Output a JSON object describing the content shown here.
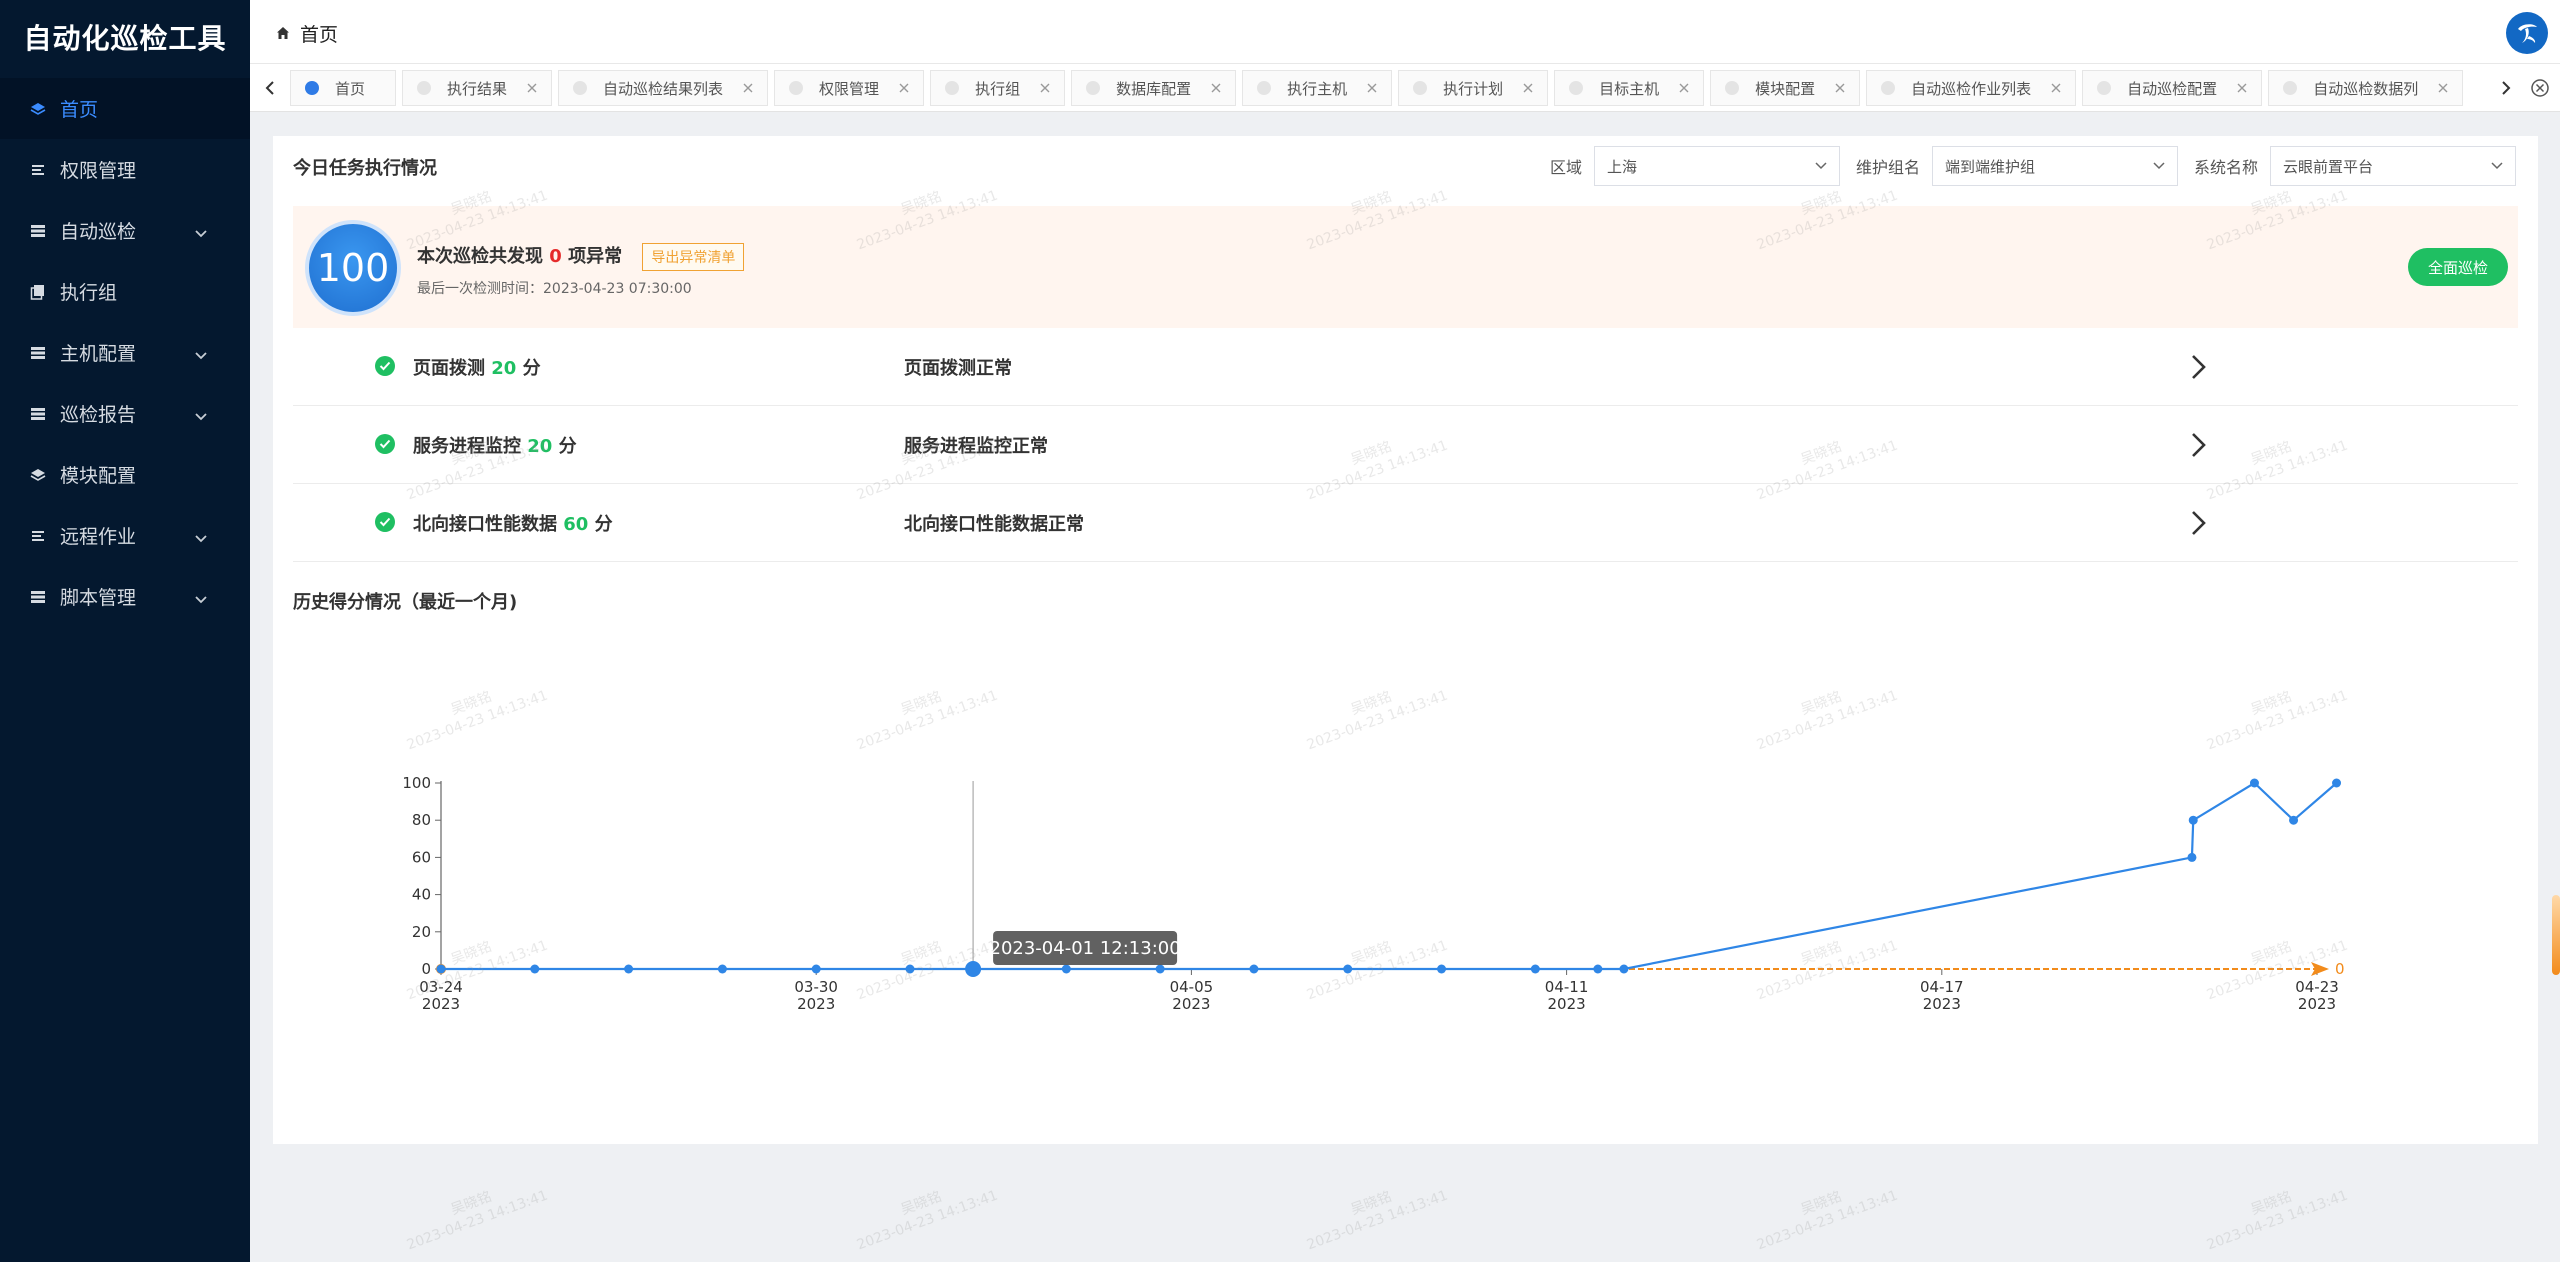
{
  "app": {
    "title": "自动化巡检工具"
  },
  "sidebar": {
    "items": [
      {
        "label": "首页",
        "icon": "layers-icon",
        "active": true,
        "has_submenu": false
      },
      {
        "label": "权限管理",
        "icon": "list-icon",
        "active": false,
        "has_submenu": false
      },
      {
        "label": "自动巡检",
        "icon": "table-icon",
        "active": false,
        "has_submenu": true
      },
      {
        "label": "执行组",
        "icon": "copy-icon",
        "active": false,
        "has_submenu": false
      },
      {
        "label": "主机配置",
        "icon": "table-icon",
        "active": false,
        "has_submenu": true
      },
      {
        "label": "巡检报告",
        "icon": "table-icon",
        "active": false,
        "has_submenu": true
      },
      {
        "label": "模块配置",
        "icon": "layers-icon",
        "active": false,
        "has_submenu": false
      },
      {
        "label": "远程作业",
        "icon": "list-icon",
        "active": false,
        "has_submenu": true
      },
      {
        "label": "脚本管理",
        "icon": "table-icon",
        "active": false,
        "has_submenu": true
      }
    ]
  },
  "header": {
    "breadcrumb": "首页",
    "brand_icon": "china-telecom-logo-icon"
  },
  "tabs": [
    {
      "label": "首页",
      "active": true
    },
    {
      "label": "执行结果",
      "active": false
    },
    {
      "label": "自动巡检结果列表",
      "active": false
    },
    {
      "label": "权限管理",
      "active": false
    },
    {
      "label": "执行组",
      "active": false
    },
    {
      "label": "数据库配置",
      "active": false
    },
    {
      "label": "执行主机",
      "active": false
    },
    {
      "label": "执行计划",
      "active": false
    },
    {
      "label": "目标主机",
      "active": false
    },
    {
      "label": "模块配置",
      "active": false
    },
    {
      "label": "自动巡检作业列表",
      "active": false
    },
    {
      "label": "自动巡检配置",
      "active": false
    },
    {
      "label": "自动巡检数据列",
      "active": false
    }
  ],
  "main": {
    "title": "今日任务执行情况",
    "filters": {
      "region_label": "区域",
      "region_value": "上海",
      "group_label": "维护组名",
      "group_value": "端到端维护组",
      "system_label": "系统名称",
      "system_value": "云眼前置平台"
    },
    "summary": {
      "score": "100",
      "text_prefix": "本次巡检共发现",
      "issue_count": "0",
      "text_suffix": "项异常",
      "export_label": "导出异常清单",
      "last_check": "最后一次检测时间：2023-04-23 07:30:00",
      "full_check_label": "全面巡检"
    },
    "checks": [
      {
        "name": "页面拨测",
        "score": "20",
        "unit": "分",
        "status": "页面拨测正常"
      },
      {
        "name": "服务进程监控",
        "score": "20",
        "unit": "分",
        "status": "服务进程监控正常"
      },
      {
        "name": "北向接口性能数据",
        "score": "60",
        "unit": "分",
        "status": "北向接口性能数据正常"
      }
    ],
    "history_title": "历史得分情况（最近一个月)"
  },
  "watermark": {
    "line1": "吴晓铭",
    "line2": "2023-04-23 14:13:41"
  },
  "chart_data": {
    "type": "line",
    "x_tick_labels": [
      [
        "03-24",
        "2023"
      ],
      [
        "03-30",
        "2023"
      ],
      [
        "04-05",
        "2023"
      ],
      [
        "04-11",
        "2023"
      ],
      [
        "04-17",
        "2023"
      ],
      [
        "04-23",
        "2023"
      ]
    ],
    "y_ticks": [
      0,
      20,
      40,
      60,
      80,
      100
    ],
    "ylim": [
      0,
      100
    ],
    "xlim": [
      "2023-03-24",
      "2023-04-23"
    ],
    "series": [
      {
        "color": "#2f86e6",
        "points": [
          [
            "2023-03-24 00:00",
            0
          ],
          [
            "2023-03-25 12:00",
            0
          ],
          [
            "2023-03-27 00:00",
            0
          ],
          [
            "2023-03-28 12:00",
            0
          ],
          [
            "2023-03-30 00:00",
            0
          ],
          [
            "2023-03-31 12:00",
            0
          ],
          [
            "2023-04-01 12:13",
            0
          ],
          [
            "2023-04-03 00:00",
            0
          ],
          [
            "2023-04-04 12:00",
            0
          ],
          [
            "2023-04-06 00:00",
            0
          ],
          [
            "2023-04-07 12:00",
            0
          ],
          [
            "2023-04-09 00:00",
            0
          ],
          [
            "2023-04-10 12:00",
            0
          ],
          [
            "2023-04-11 12:00",
            0
          ],
          [
            "2023-04-11 22:00",
            0
          ],
          [
            "2023-04-21 00:00",
            60
          ],
          [
            "2023-04-21 00:30",
            80
          ],
          [
            "2023-04-22 00:00",
            100
          ],
          [
            "2023-04-22 15:00",
            80
          ],
          [
            "2023-04-23 07:30",
            100
          ]
        ]
      }
    ],
    "baseline": {
      "color": "#f28b1b",
      "value": 0,
      "end_label": "0"
    },
    "tooltip": {
      "text": "2023-04-01 12:13:00",
      "x": "2023-04-01 12:13"
    }
  }
}
